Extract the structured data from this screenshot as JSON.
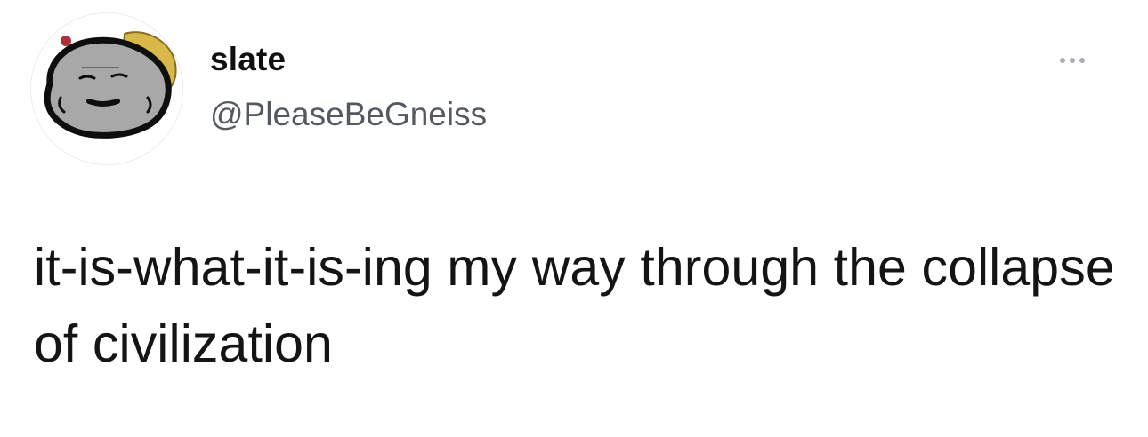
{
  "author": {
    "display_name": "slate",
    "handle": "@PleaseBeGneiss",
    "avatar_icon": "rock-face-avatar-icon"
  },
  "header": {
    "more_icon": "more-horizontal-icon"
  },
  "tweet": {
    "text": "it-is-what-it-is-ing my way through the collapse of civilization"
  },
  "colors": {
    "background": "#ffffff",
    "text": "#141414",
    "handle": "#555a60",
    "more_dots": "#a9adb2",
    "rock": "#a8a8a8",
    "hat": "#d9b84a"
  }
}
